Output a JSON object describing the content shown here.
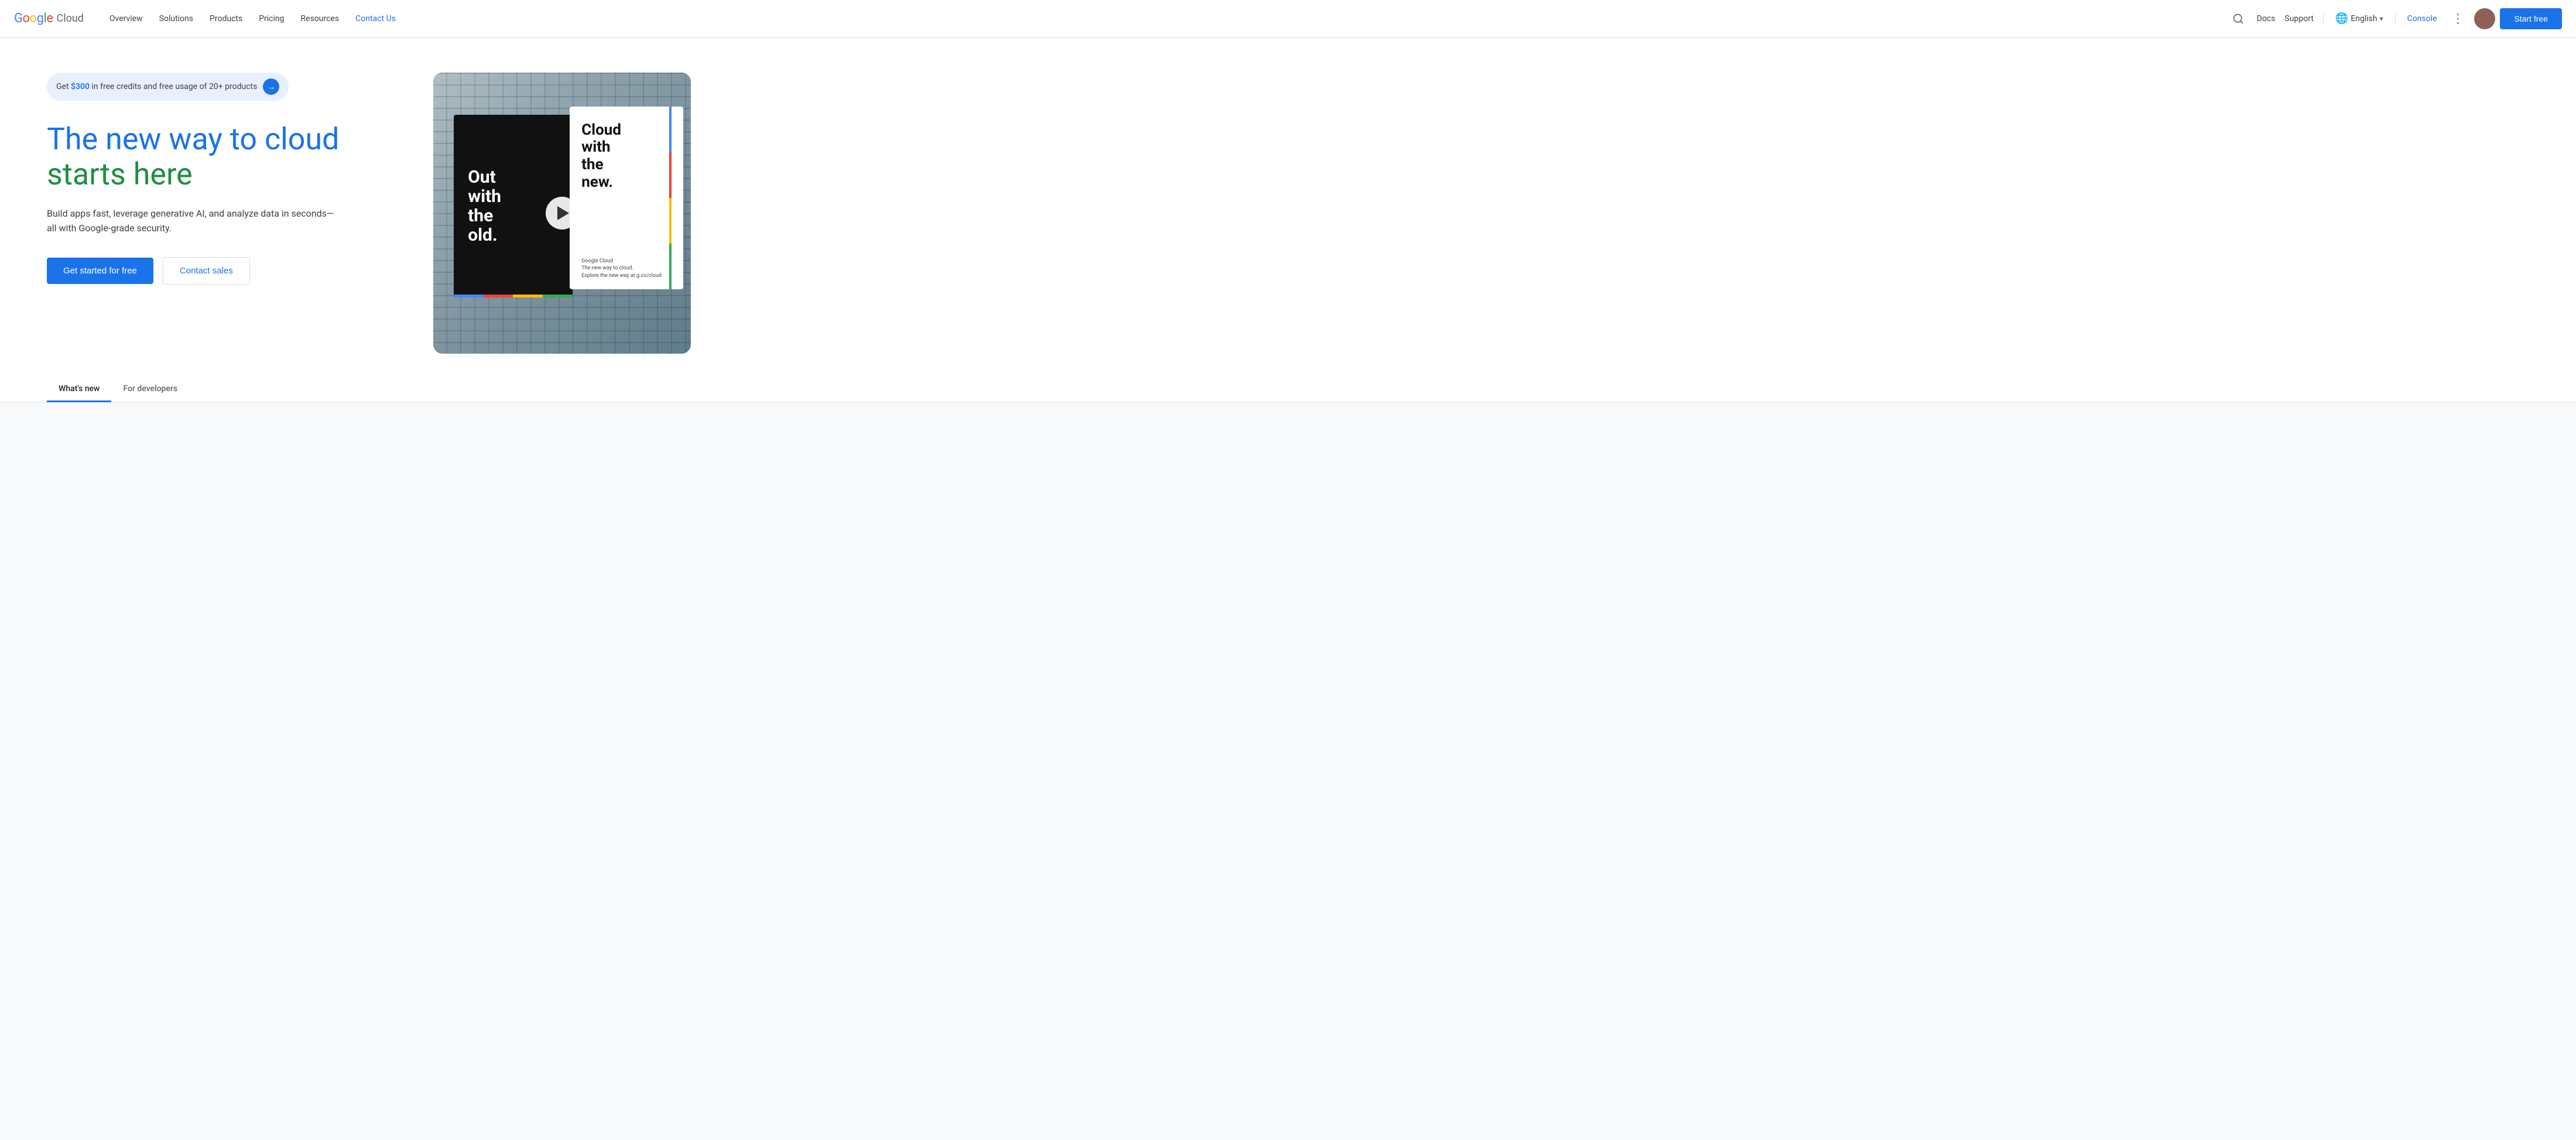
{
  "brand": {
    "name": "Google Cloud",
    "google_letters": [
      "G",
      "o",
      "o",
      "g",
      "l",
      "e"
    ],
    "cloud": "Cloud"
  },
  "navbar": {
    "links": [
      {
        "id": "overview",
        "label": "Overview"
      },
      {
        "id": "solutions",
        "label": "Solutions"
      },
      {
        "id": "products",
        "label": "Products"
      },
      {
        "id": "pricing",
        "label": "Pricing"
      },
      {
        "id": "resources",
        "label": "Resources"
      },
      {
        "id": "contact",
        "label": "Contact Us",
        "active": true
      }
    ],
    "search_aria": "Search",
    "docs_label": "Docs",
    "support_label": "Support",
    "language": "English",
    "console_label": "Console",
    "more_aria": "More options",
    "start_free_label": "Start free"
  },
  "hero": {
    "promo": {
      "prefix": "Get ",
      "amount": "$300",
      "suffix": " in free credits and free usage of 20+ products"
    },
    "title_line1": "The new way to cloud",
    "title_line2": "starts here",
    "description": "Build apps fast, leverage generative AI, and analyze data in seconds—all with Google-grade security.",
    "cta_primary": "Get started for free",
    "cta_secondary": "Contact sales"
  },
  "video": {
    "billboard_left_lines": [
      "Out",
      "with",
      "the",
      "old."
    ],
    "billboard_right_lines": [
      "Cloud",
      "with",
      "the",
      "new."
    ],
    "tagline": "Google Cloud",
    "sub_tagline": "The new way to cloud.",
    "sub_text": "Explore the new way at g.co/cloud",
    "play_aria": "Play video"
  },
  "tabs": [
    {
      "id": "whats-new",
      "label": "What's new",
      "active": true
    },
    {
      "id": "for-developers",
      "label": "For developers",
      "active": false
    }
  ]
}
